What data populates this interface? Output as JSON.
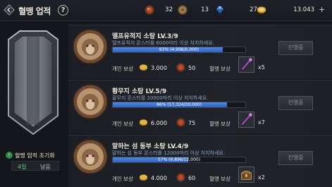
{
  "header": {
    "title": "혈맹 업적",
    "help": "?",
    "currencies": [
      {
        "name": "bloodstone",
        "icon": "red-orb-icon",
        "value": "32"
      },
      {
        "name": "medal",
        "icon": "bronze-medal-icon",
        "value": "13"
      },
      {
        "name": "diamond",
        "icon": "blue-gem-icon",
        "value": "27",
        "plus": "+"
      },
      {
        "name": "adena",
        "icon": "gold-coin-icon",
        "value": "13.043",
        "plus": "+"
      }
    ]
  },
  "left": {
    "reset_icon": "!",
    "reset_label": "혈맹 업적 초기화",
    "remain_days": "4일",
    "remain_label": "남음"
  },
  "quests": [
    {
      "title": "엘프유적지 소탕 LV.3/9",
      "desc": "엘프유적지 몬스터를 6000마리 이상 처치하세요.",
      "progress_text": "83% (4,998/6,000)",
      "progress": 0.83,
      "personal_label": "개인 보상",
      "coin_value": "3.000",
      "gem_value": "50",
      "clan_label": "혈맹 보상",
      "item_icon": "staff-icon",
      "item_count": "x5",
      "button": "진행중"
    },
    {
      "title": "황무지 소탕 LV.5/9",
      "desc": "황무지 몬스터를 20000마리 이상 처치하세요.",
      "progress_text": "86% (17,324/20,000)",
      "progress": 0.86,
      "personal_label": "개인 보상",
      "coin_value": "6.000",
      "gem_value": "75",
      "clan_label": "혈맹 보상",
      "item_icon": "staff-icon",
      "item_count": "x7",
      "button": "진행중"
    },
    {
      "title": "말하는 섬 동부 소탕 LV.4/9",
      "desc": "말하는 섬 동부 몬스터를 12000마리 이상 처치하세요.",
      "progress_text": "57% (6,896/12,000)",
      "progress": 0.57,
      "personal_label": "개인 보상",
      "coin_value": "4.000",
      "gem_value": "60",
      "clan_label": "혈맹 보상",
      "item_icon": "treasure-chest-icon",
      "item_count": "x2",
      "button": "진행중"
    }
  ]
}
